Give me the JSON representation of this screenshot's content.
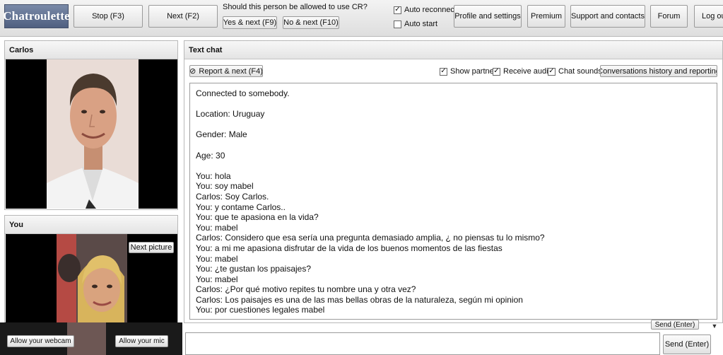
{
  "app": {
    "logo": "Chatroulette"
  },
  "topbar": {
    "stop_label": "Stop (F3)",
    "next_label": "Next (F2)",
    "cr_question": "Should this person be allowed to use CR?",
    "yes_next_label": "Yes & next (F9)",
    "no_next_label": "No & next (F10)",
    "auto_reconnect_label": "Auto reconnect",
    "auto_reconnect_checked": true,
    "auto_start_label": "Auto start",
    "auto_start_checked": false,
    "profile_label": "Profile and settings",
    "premium_label": "Premium",
    "support_label": "Support and contacts",
    "forum_label": "Forum",
    "logout_label": "Log ou"
  },
  "partner_panel": {
    "title": "Carlos"
  },
  "you_panel": {
    "title": "You",
    "next_picture_label": "Next picture",
    "allow_webcam_label": "Allow your webcam",
    "allow_mic_label": "Allow your mic"
  },
  "chat": {
    "title": "Text chat",
    "report_label": "Report & next (F4)",
    "show_partner_label": "Show partner",
    "receive_audio_label": "Receive audio",
    "chat_sounds_label": "Chat sounds",
    "history_label": "Conversations history and reporting",
    "send_label": "Send (Enter)",
    "send_label_partial": "Send (Enter)",
    "messages": [
      "Connected to somebody.",
      "",
      "Location: Uruguay",
      "",
      "Gender: Male",
      "",
      "Age: 30",
      "",
      "You: hola",
      "You: soy mabel",
      "Carlos: Soy Carlos.",
      "You: y contame Carlos..",
      "You: que te apasiona en la vida?",
      "You: mabel",
      "Carlos: Considero que esa sería una pregunta demasiado amplia, ¿ no piensas tu lo mismo?",
      "You: a mi me apasiona disfrutar de la vida de los buenos momentos de las fiestas",
      "You: mabel",
      "You: ¿te gustan los ppaisajes?",
      "You: mabel",
      "Carlos: ¿Por qué motivo repites tu nombre una y otra vez?",
      "Carlos: Los paisajes es una de las mas bellas obras de la naturaleza, según mi opinion",
      "You: por cuestiones legales mabel"
    ]
  }
}
